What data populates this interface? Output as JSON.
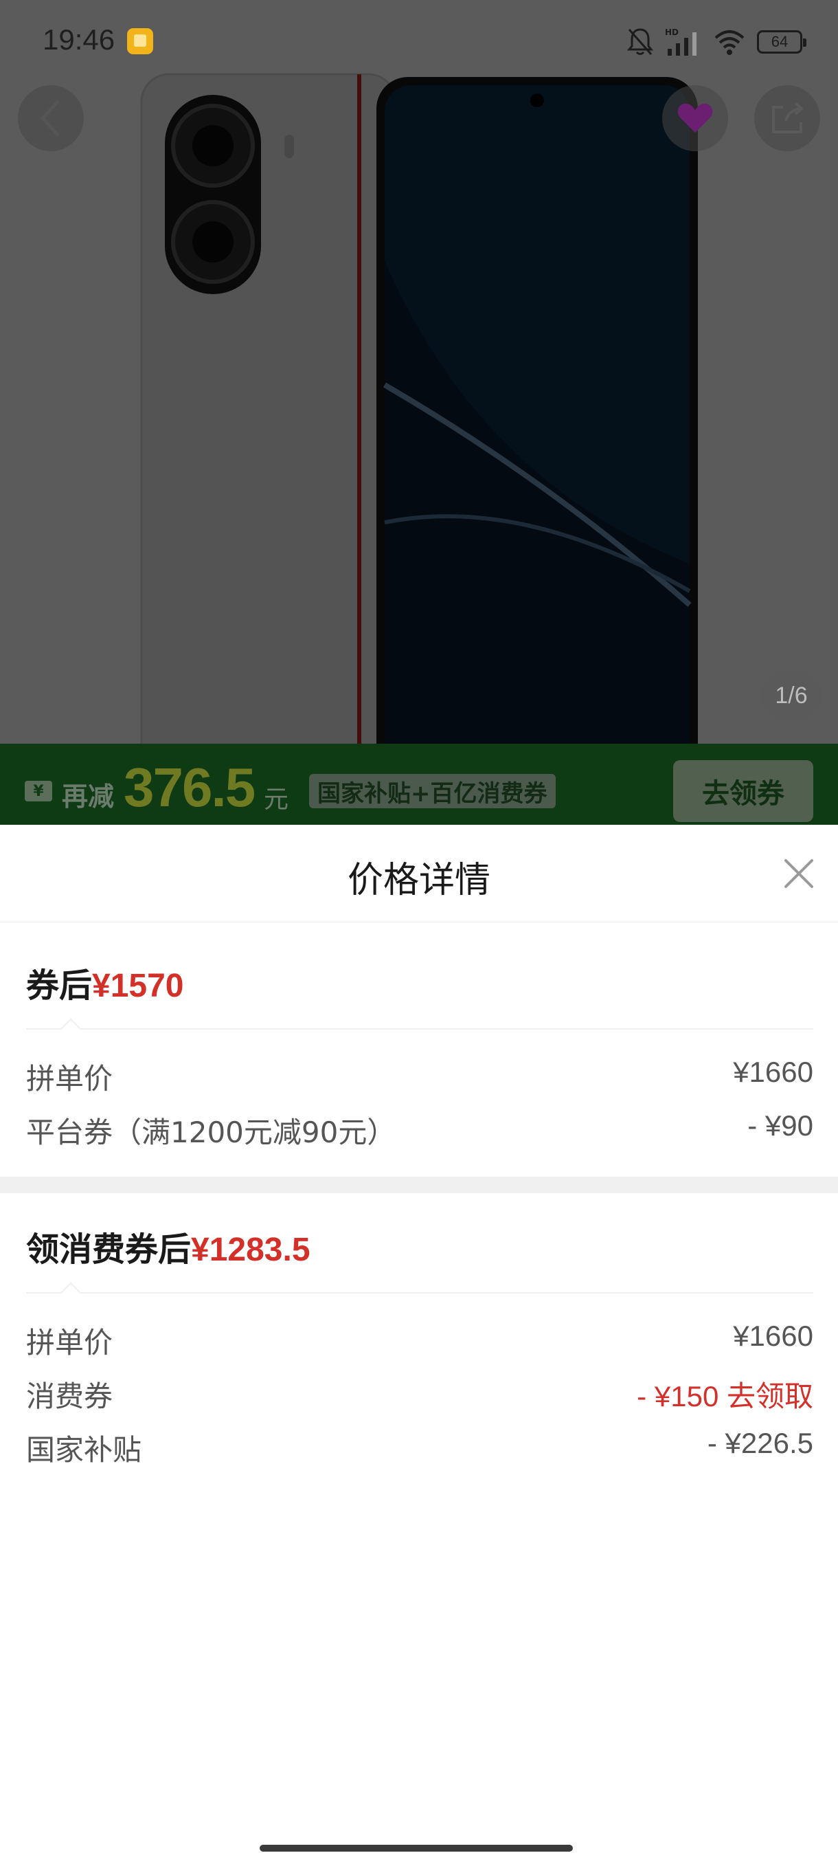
{
  "status_bar": {
    "time": "19:46",
    "battery": "64",
    "icons": [
      "notification-muted-icon",
      "hd-signal-icon",
      "wifi-icon",
      "battery-icon"
    ]
  },
  "product": {
    "page_indicator": "1/6"
  },
  "promo": {
    "ticket_icon": "¥",
    "label": "再减",
    "amount": "376.5",
    "unit": "元",
    "tag": "国家补贴+百亿消费券",
    "button": "去领券"
  },
  "sheet": {
    "title": "价格详情",
    "section1": {
      "heading_prefix": "券后",
      "heading_price": "¥1570",
      "rows": [
        {
          "label": "拼单价",
          "value": "¥1660"
        },
        {
          "label": "平台券（满1200元减90元）",
          "value": "- ¥90"
        }
      ]
    },
    "section2": {
      "heading_prefix": "领消费券后",
      "heading_price": "¥1283.5",
      "rows": [
        {
          "label": "拼单价",
          "value": "¥1660"
        },
        {
          "label": "消费券",
          "value": "- ¥150",
          "link": "去领取"
        },
        {
          "label": "国家补贴",
          "value": "- ¥226.5"
        }
      ]
    }
  },
  "colors": {
    "accent_red": "#d4302a",
    "promo_green": "#0e3a14"
  }
}
